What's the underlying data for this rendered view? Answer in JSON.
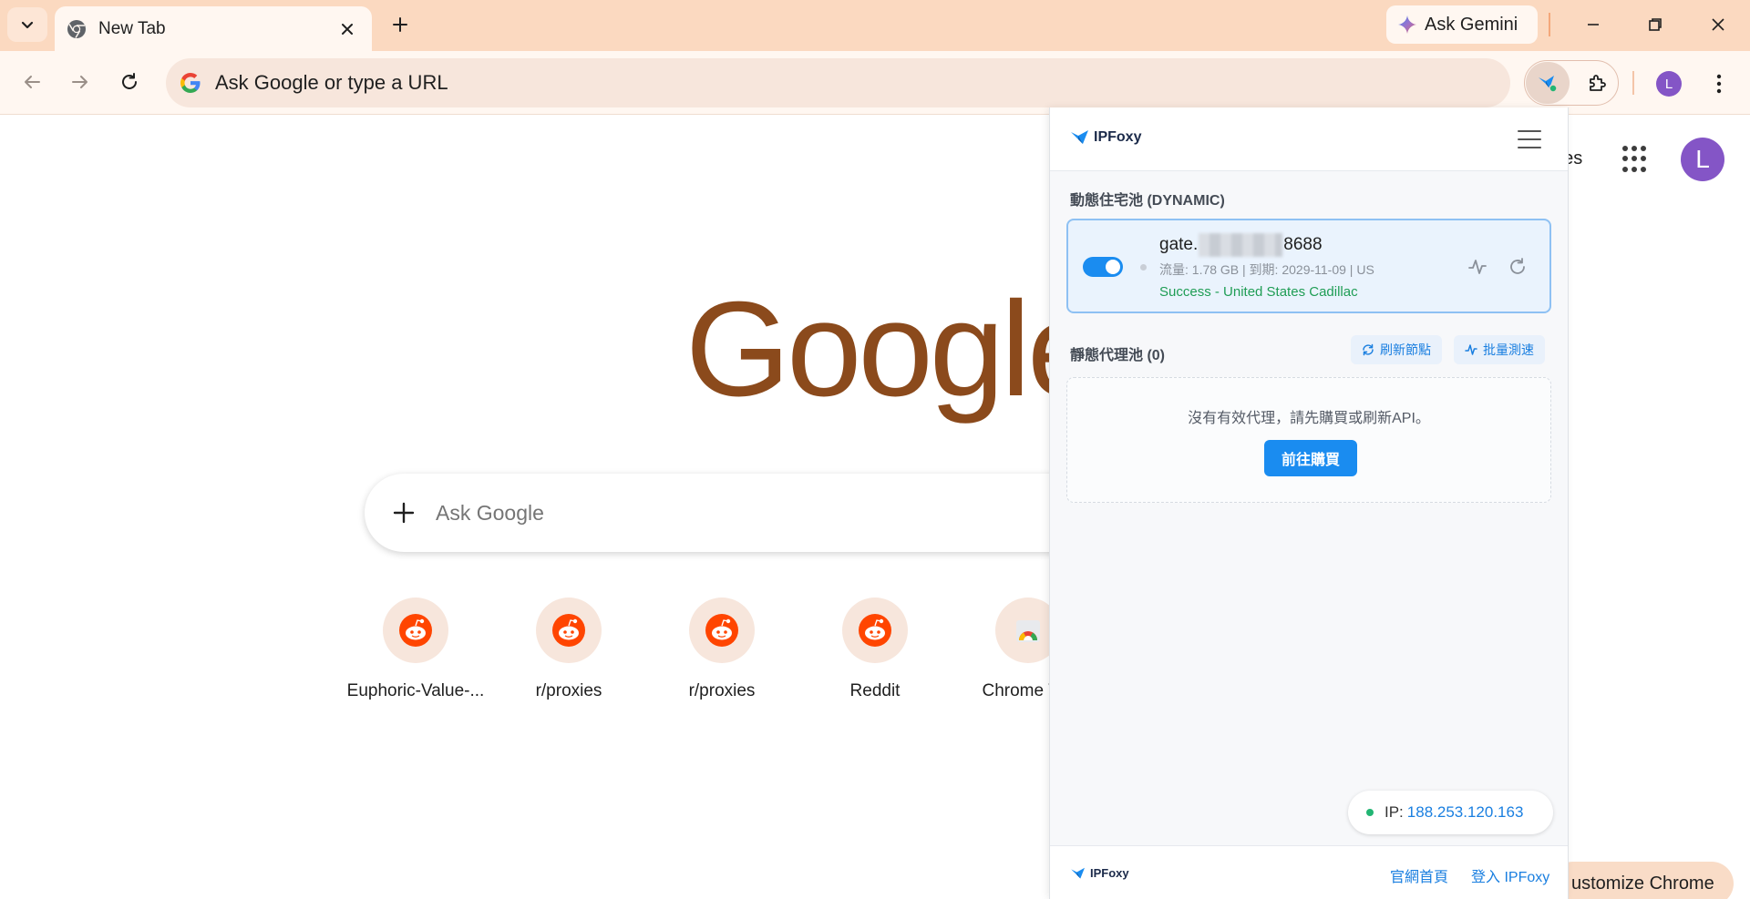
{
  "browser": {
    "tab_title": "New Tab",
    "gemini_label": "Ask Gemini",
    "omnibox_placeholder": "Ask Google or type a URL",
    "profile_initial": "L"
  },
  "ntp": {
    "images_link": "ges",
    "logo_text": "Google",
    "search_placeholder": "Ask Google",
    "profile_initial": "L",
    "customize_label": "ustomize Chrome",
    "shortcuts": [
      {
        "label": "Euphoric-Value-..."
      },
      {
        "label": "r/proxies"
      },
      {
        "label": "r/proxies"
      },
      {
        "label": "Reddit"
      },
      {
        "label": "Chrome We"
      }
    ]
  },
  "ipfoxy": {
    "brand": "IPFoxy",
    "dynamic_title": "動態住宅池 (DYNAMIC)",
    "proxy": {
      "host_prefix": "gate.",
      "host_suffix": "8688",
      "meta": "流量: 1.78 GB | 到期: 2029-11-09 | US",
      "status": "Success - United States Cadillac",
      "enabled": true
    },
    "static_title": "靜態代理池 (0)",
    "refresh_nodes_label": "刷新節點",
    "batch_speed_label": "批量測速",
    "empty_message": "沒有有效代理，請先購買或刷新API。",
    "buy_label": "前往購買",
    "ip_label": "IP:",
    "ip_value": "188.253.120.163",
    "footer": {
      "brand": "IPFoxy",
      "homepage_label": "官網首頁",
      "login_label": "登入 IPFoxy"
    }
  },
  "colors": {
    "titlebar": "#fbd9c0",
    "toolbar": "#fff7f1",
    "google_logo": "#8b4a1c",
    "ipfoxy_accent": "#1a8cf0",
    "success": "#1f9d55"
  }
}
